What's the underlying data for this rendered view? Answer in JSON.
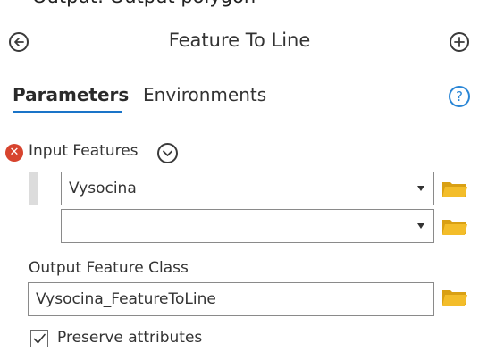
{
  "header": {
    "cut_text": "Output: Output polygon",
    "title": "Feature To Line",
    "icons": {
      "back": "back-arrow-circle-icon",
      "add": "plus-circle-icon"
    }
  },
  "tabs": [
    {
      "label": "Parameters",
      "active": true
    },
    {
      "label": "Environments",
      "active": false
    }
  ],
  "help": {
    "icon": "help-question-icon",
    "symbol": "?"
  },
  "input_features": {
    "label": "Input Features",
    "status": "error",
    "error_symbol": "✕",
    "values": [
      "Vysocina",
      ""
    ]
  },
  "output_feature_class": {
    "label": "Output Feature Class",
    "value": "Vysocina_FeatureToLine"
  },
  "preserve_attributes": {
    "label": "Preserve attributes",
    "checked": true
  },
  "colors": {
    "accent": "#1a74c8",
    "error": "#d7442e",
    "folder": "#f0b81a"
  }
}
